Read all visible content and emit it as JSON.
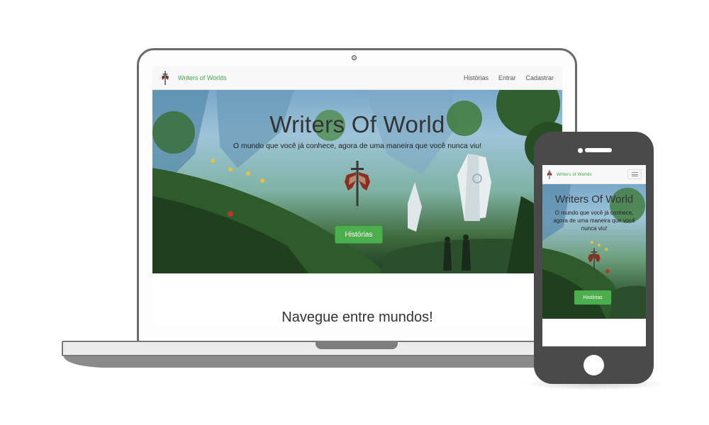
{
  "desktop": {
    "nav": {
      "brand": "Writers of Worlds",
      "links": [
        "Histórias",
        "Entrar",
        "Cadastrar"
      ]
    },
    "hero": {
      "title": "Writers Of World",
      "subtitle": "O mundo que você já conhece, agora de uma maneira que você nunca viu!",
      "button_label": "Histórias"
    },
    "section_title": "Navegue entre mundos!"
  },
  "mobile": {
    "nav": {
      "brand": "Writers of Worlds",
      "menu_icon": "hamburger-icon"
    },
    "hero": {
      "title": "Writers Of World",
      "subtitle": "O mundo que você já conhece, agora de uma maneira que você nunca viu!",
      "button_label": "Histórias"
    }
  },
  "colors": {
    "brand_green": "#3ea84a",
    "button_green": "#4cae4c",
    "device_gray": "#4a4a4a"
  },
  "icons": {
    "logo": "winged-sword-logo-icon",
    "emblem": "winged-sword-emblem-icon"
  }
}
